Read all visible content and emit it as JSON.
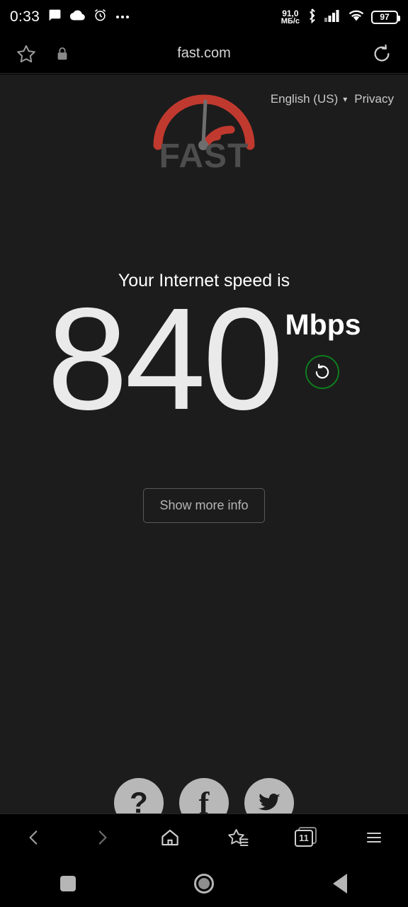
{
  "status_bar": {
    "clock": "0:33",
    "net_rate_value": "91,0",
    "net_rate_unit": "МБ/с",
    "battery_percent": "97",
    "icons": [
      "chat-icon",
      "cloud-icon",
      "alarm-icon",
      "more-icon",
      "bluetooth-icon",
      "cellular-signal-icon",
      "wifi-icon",
      "battery-icon"
    ]
  },
  "browser": {
    "url": "fast.com",
    "address_icons": [
      "bookmark-star-icon",
      "lock-icon",
      "reload-icon"
    ],
    "bottom_toolbar": {
      "back": "back-icon",
      "forward": "forward-icon",
      "home": "home-icon",
      "bookmarks": "bookmarks-star-icon",
      "tabs_count": "11",
      "menu": "menu-icon"
    }
  },
  "page": {
    "language": "English (US)",
    "privacy": "Privacy",
    "logo_word": "FAST",
    "headline": "Your Internet speed is",
    "speed_value": "840",
    "speed_unit": "Mbps",
    "retry_icon": "refresh-icon",
    "more_info_label": "Show more info",
    "socials": [
      {
        "name": "help-icon",
        "glyph": "?"
      },
      {
        "name": "facebook-icon",
        "glyph": "f"
      },
      {
        "name": "twitter-icon",
        "glyph": ""
      }
    ],
    "colors": {
      "background": "#1c1c1c",
      "logo_red": "#c0392f",
      "retry_green": "#0f7a1e",
      "speed_text": "#eaeaea"
    }
  },
  "android_nav": {
    "recents": "square-recents-icon",
    "home": "circle-home-icon",
    "back": "triangle-back-icon"
  }
}
